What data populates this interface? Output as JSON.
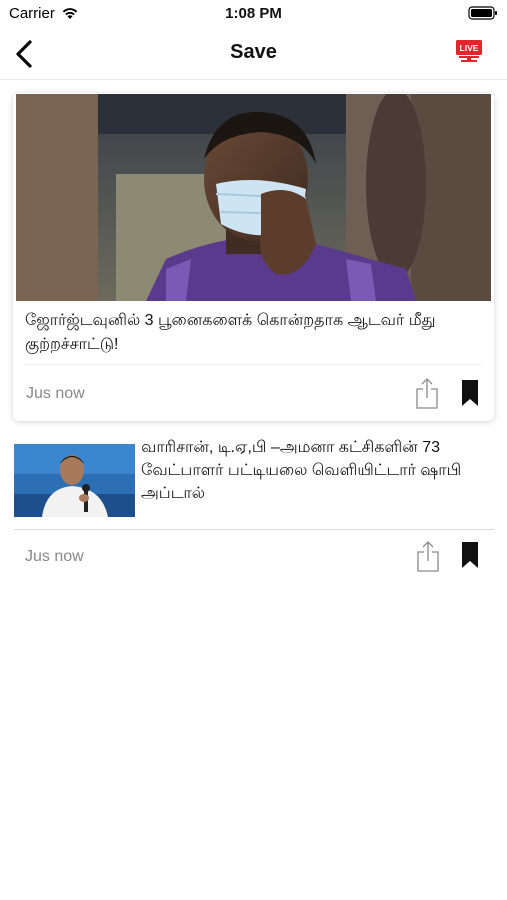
{
  "status_bar": {
    "carrier": "Carrier",
    "time": "1:08 PM",
    "icons": [
      "wifi-icon",
      "battery-icon"
    ]
  },
  "nav": {
    "title": "Save",
    "back_icon": "chevron-left-icon",
    "live_label": "LIVE",
    "live_icon": "live-tv-icon",
    "accent_color": "#e0252c"
  },
  "articles": [
    {
      "title": "ஜோர்ஜ்டவுனில் 3 பூனைகளைக் கொன்றதாக ஆடவர் மீது குற்றச்சாட்டு!",
      "time": "Jus now",
      "share_icon": "share-icon",
      "bookmark_icon": "bookmark-icon"
    },
    {
      "title": "வாரிசான், டி.ஏ,பி –அமனா கட்சிகளின் 73 வேட்பாளர் பட்டியலை வெளியிட்டார் ஷாபி அப்டால்",
      "time": "Jus now",
      "share_icon": "share-icon",
      "bookmark_icon": "bookmark-icon"
    }
  ]
}
